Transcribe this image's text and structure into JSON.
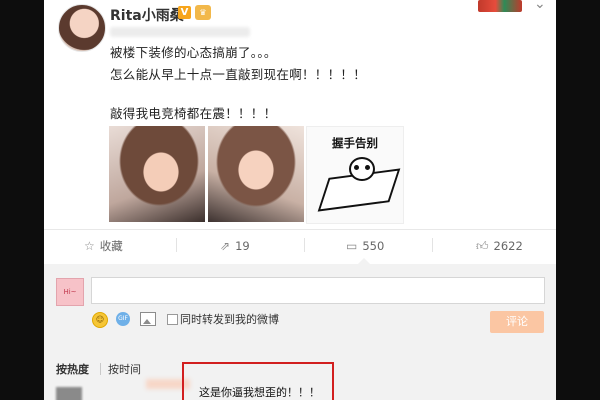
{
  "post": {
    "username": "Rita小雨桑",
    "verified_icon": "verified-v-icon",
    "lines": [
      "被楼下装修的心态搞崩了。。。",
      "怎么能从早上十点一直敲到现在啊！！！！！",
      "",
      "敲得我电竞椅都在震！！！！"
    ],
    "meme_title": "握手告别"
  },
  "actions": {
    "favorite_label": "收藏",
    "repost_count": "19",
    "comment_count": "550",
    "like_count": "2622"
  },
  "comment_box": {
    "avatar_text": "Hi~",
    "repost_also_label": "同时转发到我的微博",
    "submit_label": "评论"
  },
  "comments": {
    "sort_hot": "按热度",
    "sort_time": "按时间",
    "top_comment_text": "这是你逼我想歪的！！！"
  },
  "colors": {
    "accent_orange": "#f7a51c",
    "submit_disabled": "#fbc6a3",
    "highlight_red": "#d21f1f"
  }
}
